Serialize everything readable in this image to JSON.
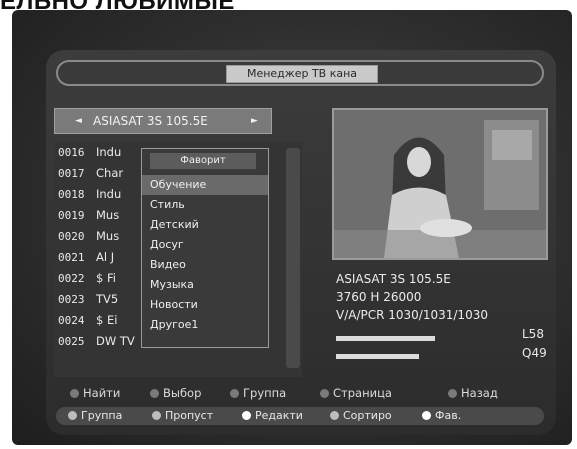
{
  "page_heading": "ЕЛЬНО ЛЮБИМЫЕ",
  "window": {
    "title": "Менеджер ТВ кана"
  },
  "satellite_bar": {
    "left_arrow": "◄",
    "right_arrow": "►",
    "name": "ASIASAT 3S 105.5E"
  },
  "channels": [
    {
      "num": "0016",
      "name": "Indu"
    },
    {
      "num": "0017",
      "name": "Char"
    },
    {
      "num": "0018",
      "name": "Indu"
    },
    {
      "num": "0019",
      "name": "Mus"
    },
    {
      "num": "0020",
      "name": "Mus"
    },
    {
      "num": "0021",
      "name": "Al J"
    },
    {
      "num": "0022",
      "name": "$ Fi"
    },
    {
      "num": "0023",
      "name": "TV5"
    },
    {
      "num": "0024",
      "name": "$ Ei"
    },
    {
      "num": "0025",
      "name": "DW TV"
    }
  ],
  "favorites_popup": {
    "title": "Фаворит",
    "selected_index": 0,
    "items": [
      "Обучение",
      "Стиль",
      "Детский",
      "Досуг",
      "Видео",
      "Музыка",
      "Новости",
      "Другое1"
    ]
  },
  "info": {
    "satellite": "ASIASAT 3S 105.5E",
    "transponder": "3760 H 26000",
    "pids": "V/A/PCR 1030/1031/1030"
  },
  "signal": {
    "level_label": "L58",
    "level": 0.58,
    "quality_label": "Q49",
    "quality": 0.49
  },
  "hints": [
    "Найти",
    "Выбор",
    "Группа",
    "Страница",
    "Назад"
  ],
  "color_keys": [
    {
      "label": "Группа",
      "color": "#bdbdbd"
    },
    {
      "label": "Пропуст",
      "color": "#bdbdbd"
    },
    {
      "label": "Редакти",
      "color": "#ffffff"
    },
    {
      "label": "Сортиро",
      "color": "#bdbdbd"
    },
    {
      "label": "Фав.",
      "color": "#ffffff"
    }
  ]
}
